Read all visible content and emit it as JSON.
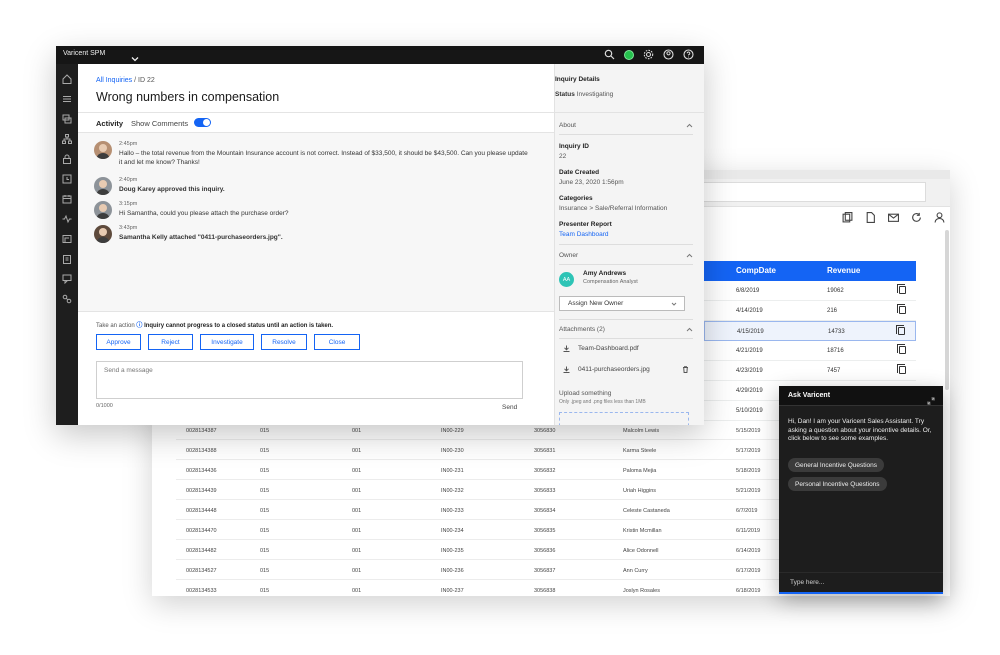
{
  "back_table": {
    "headers": [
      "CompDate",
      "Revenue"
    ],
    "upper_rows": [
      {
        "date": "6/8/2019",
        "revenue": "19062"
      },
      {
        "date": "4/14/2019",
        "revenue": "216"
      },
      {
        "date": "4/15/2019",
        "revenue": "14733"
      },
      {
        "date": "4/21/2019",
        "revenue": "18716"
      },
      {
        "date": "4/23/2019",
        "revenue": "7457"
      },
      {
        "date": "4/29/2019",
        "revenue": ""
      },
      {
        "date": "5/10/2019",
        "revenue": ""
      }
    ],
    "rows": [
      {
        "id": "0028134387",
        "c1": "015",
        "c2": "001",
        "code": "IN00-229",
        "num": "3056830",
        "name": "Malcolm Lewis",
        "date": "5/15/2019"
      },
      {
        "id": "0028134388",
        "c1": "015",
        "c2": "001",
        "code": "IN00-230",
        "num": "3056831",
        "name": "Karma Steele",
        "date": "5/17/2019"
      },
      {
        "id": "0028134436",
        "c1": "015",
        "c2": "001",
        "code": "IN00-231",
        "num": "3056832",
        "name": "Paloma Mejia",
        "date": "5/18/2019"
      },
      {
        "id": "0028134439",
        "c1": "015",
        "c2": "001",
        "code": "IN00-232",
        "num": "3056833",
        "name": "Uriah Higgins",
        "date": "5/21/2019"
      },
      {
        "id": "0028134448",
        "c1": "015",
        "c2": "001",
        "code": "IN00-233",
        "num": "3056834",
        "name": "Celeste Castaneda",
        "date": "6/7/2019"
      },
      {
        "id": "0028134470",
        "c1": "015",
        "c2": "001",
        "code": "IN00-234",
        "num": "3056835",
        "name": "Kristin Mcmillan",
        "date": "6/11/2019"
      },
      {
        "id": "0028134482",
        "c1": "015",
        "c2": "001",
        "code": "IN00-235",
        "num": "3056836",
        "name": "Alice Odonnell",
        "date": "6/14/2019"
      },
      {
        "id": "0028134527",
        "c1": "015",
        "c2": "001",
        "code": "IN00-236",
        "num": "3056837",
        "name": "Ann Curry",
        "date": "6/17/2019"
      },
      {
        "id": "0028134533",
        "c1": "015",
        "c2": "001",
        "code": "IN00-237",
        "num": "3056838",
        "name": "Joslyn Rosales",
        "date": "6/18/2019"
      }
    ]
  },
  "app": {
    "name": "Varicent SPM",
    "nav_icons": [
      "search-icon",
      "status-dot",
      "gear-icon",
      "user-icon",
      "help-icon"
    ]
  },
  "rail_icons": [
    "home-icon",
    "list-icon",
    "layers-icon",
    "hierarchy-icon",
    "lock-icon",
    "clock-icon",
    "calendar-icon",
    "pulse-icon",
    "flag-icon",
    "clipboard-icon",
    "chat-icon",
    "link-icon"
  ],
  "inquiry": {
    "breadcrumb_link": "All Inquiries",
    "breadcrumb_sep": "/",
    "breadcrumb_id": "ID 22",
    "title": "Wrong numbers in compensation",
    "activity_tab": "Activity",
    "show_comments": "Show Comments",
    "feed": [
      {
        "time": "2:45pm",
        "text": "Hallo – the total revenue from the Mountain Insurance account is not correct. Instead of $33,500, it should be $43,500. Can you please update it and let me know? Thanks!",
        "bold": false
      },
      {
        "time": "2:40pm",
        "text": "Doug Karey approved this inquiry.",
        "bold": true
      },
      {
        "time": "3:15pm",
        "text": "Hi Samantha, could you please attach the purchase order?",
        "bold": false
      },
      {
        "time": "3:43pm",
        "text": "Samantha Kelly attached \"0411-purchaseorders.jpg\".",
        "bold": true
      }
    ],
    "action_prefix": "Take an action",
    "action_info": "ⓘ",
    "action_warning": "Inquiry cannot progress to a closed status until an action is taken.",
    "actions": [
      "Approve",
      "Reject",
      "Investigate",
      "Resolve",
      "Close"
    ],
    "message_placeholder": "Send a message",
    "char_count": "0/1000",
    "send": "Send"
  },
  "details": {
    "title": "Inquiry Details",
    "status_label": "Status",
    "status_value": "Investigating",
    "about": "About",
    "fields": [
      {
        "label": "Inquiry ID",
        "value": "22",
        "link": false
      },
      {
        "label": "Date Created",
        "value": "June 23, 2020 1:56pm",
        "link": false
      },
      {
        "label": "Categories",
        "value": "Insurance > Sale/Referral Information",
        "link": false
      },
      {
        "label": "Presenter Report",
        "value": "Team Dashboard",
        "link": true
      }
    ],
    "owner_section": "Owner",
    "owner_initials": "AA",
    "owner_name": "Amy Andrews",
    "owner_role": "Compensation Analyst",
    "assign_owner": "Assign New Owner",
    "attachments_section": "Attachments (2)",
    "attachments": [
      "Team-Dashboard.pdf",
      "0411-purchaseorders.jpg"
    ],
    "upload_title": "Upload something",
    "upload_hint": "Only .jpeg and .png files less than 1MB"
  },
  "chat": {
    "title": "Ask Varicent",
    "greeting": "Hi, Dan! I am your Varicent Sales Assistant. Try asking a question about your incentive details. Or, click below to see some examples.",
    "chips": [
      "General Incentive Questions",
      "Personal Incentive Questions"
    ],
    "input_placeholder": "Type here..."
  },
  "colors": {
    "accent": "#1464f4",
    "nav": "#161616",
    "status_green": "#26c24e",
    "chat_bg": "#1d1d1d"
  }
}
